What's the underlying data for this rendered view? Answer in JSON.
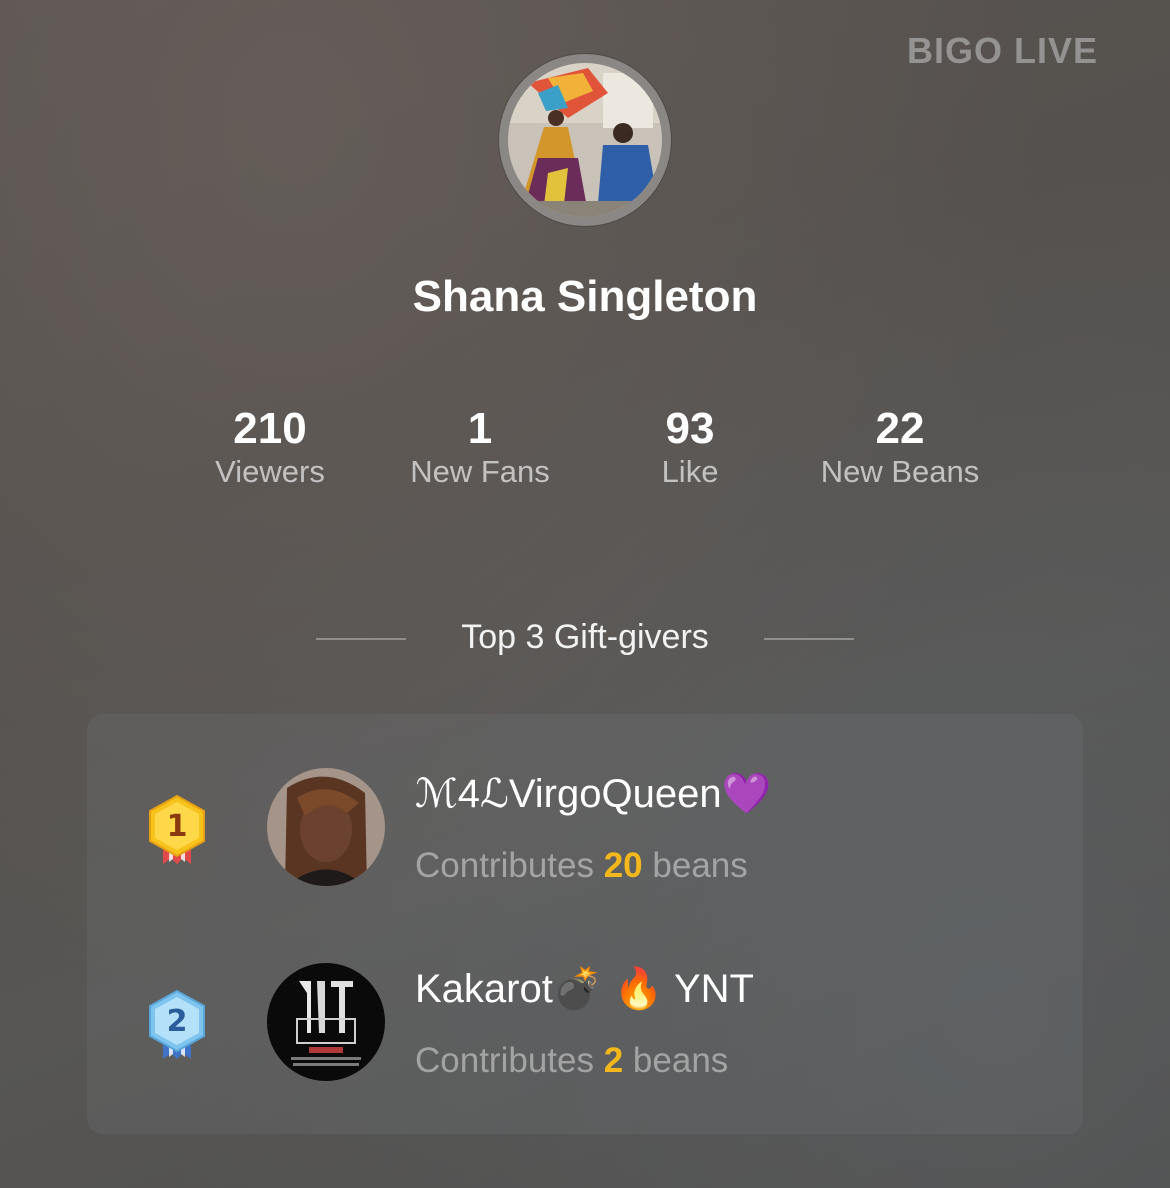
{
  "brand": "BIGO LIVE",
  "host": {
    "name": "Shana Singleton"
  },
  "stats": [
    {
      "value": "210",
      "label": "Viewers"
    },
    {
      "value": "1",
      "label": "New Fans"
    },
    {
      "value": "93",
      "label": "Like"
    },
    {
      "value": "22",
      "label": "New Beans"
    }
  ],
  "gift_section": {
    "title": "Top 3 Gift-givers",
    "prefix": "Contributes",
    "suffix": "beans",
    "givers": [
      {
        "rank": "1",
        "name": "ℳ4ℒVirgoQueen💜",
        "amount": "20"
      },
      {
        "rank": "2",
        "name": "Kakarot💣 🔥 YNT",
        "amount": "2"
      }
    ]
  },
  "colors": {
    "accent": "#f5b81c",
    "gold_medal": "#f7c21b",
    "silver_medal": "#7fc4ee"
  }
}
